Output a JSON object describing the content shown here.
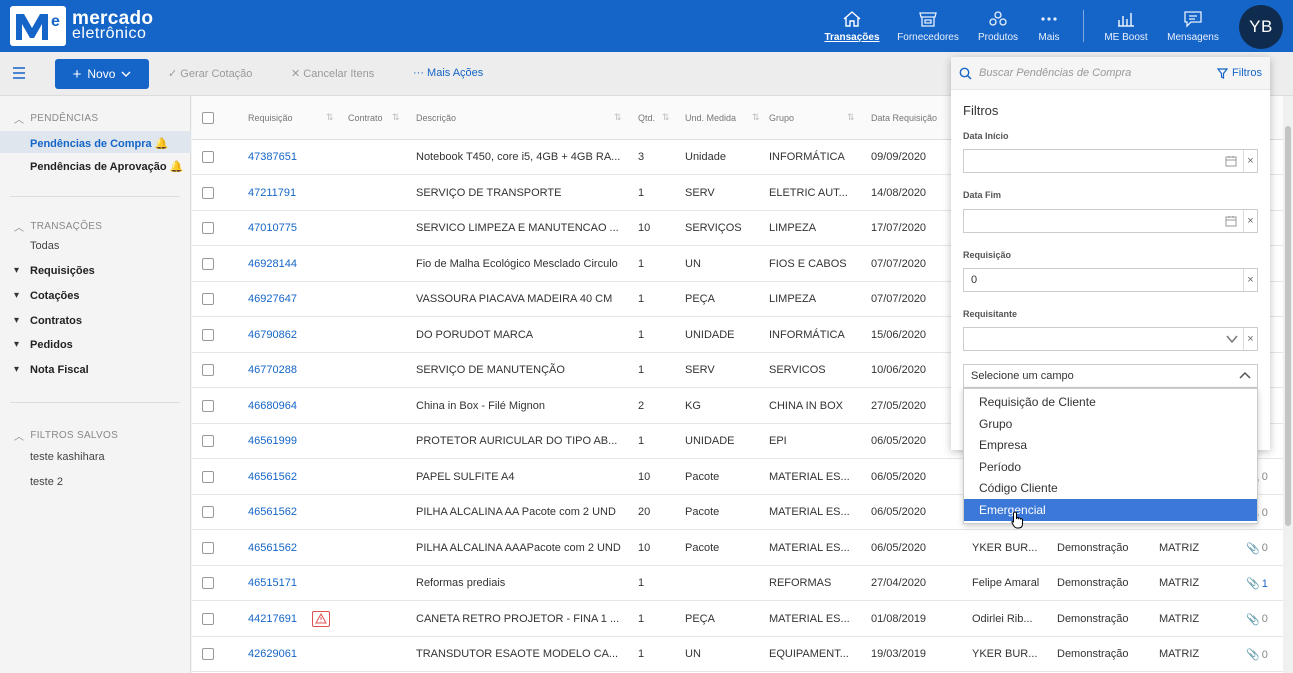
{
  "app": {
    "logo_line1": "mercado",
    "logo_line2": "eletrônico",
    "logo_letters": "Me",
    "brand_color": "#1565c8"
  },
  "topnav": {
    "items": [
      {
        "label": "Transações",
        "icon": "home-icon",
        "active": true
      },
      {
        "label": "Fornecedores",
        "icon": "store-icon"
      },
      {
        "label": "Produtos",
        "icon": "products-icon"
      },
      {
        "label": "Mais",
        "icon": "more-dots-icon"
      },
      {
        "label": "ME Boost",
        "icon": "chart-icon"
      },
      {
        "label": "Mensagens",
        "icon": "message-icon"
      }
    ],
    "avatar_initials": "YB"
  },
  "toolbar": {
    "new_label": "Novo",
    "actions": [
      "✓ Gerar Cotação",
      "✕ Cancelar Itens",
      "··· Mais Ações"
    ]
  },
  "sidebar": {
    "pendencias_title": "PENDÊNCIAS",
    "pendencias_items": [
      "Pendências de Compra",
      "Pendências de Aprovação"
    ],
    "transacoes_title": "TRANSAÇÕES",
    "todas": "Todas",
    "transacoes_items": [
      "Requisições",
      "Cotações",
      "Contratos",
      "Pedidos",
      "Nota Fiscal"
    ],
    "filtros_title": "FILTROS SALVOS",
    "filtros_items": [
      "teste kashihara",
      "teste 2"
    ]
  },
  "table": {
    "headers": [
      "Requisição",
      "Contrato",
      "Descrição",
      "Qtd.",
      "Und. Medida",
      "Grupo",
      "Data Requisição"
    ],
    "rows": [
      {
        "req": "47387651",
        "desc": "Notebook T450, core i5, 4GB + 4GB RA...",
        "qtd": "3",
        "und": "Unidade",
        "grupo": "INFORMÁTICA",
        "data": "09/09/2020"
      },
      {
        "req": "47211791",
        "desc": "SERVIÇO DE TRANSPORTE",
        "qtd": "1",
        "und": "SERV",
        "grupo": "ELETRIC AUT...",
        "data": "14/08/2020"
      },
      {
        "req": "47010775",
        "desc": "SERVICO LIMPEZA E MANUTENCAO ...",
        "qtd": "10",
        "und": "SERVIÇOS",
        "grupo": "LIMPEZA",
        "data": "17/07/2020"
      },
      {
        "req": "46928144",
        "desc": "Fio de Malha Ecológico Mesclado Circulo",
        "qtd": "1",
        "und": "UN",
        "grupo": "FIOS E CABOS",
        "data": "07/07/2020"
      },
      {
        "req": "46927647",
        "desc": "VASSOURA PIACAVA MADEIRA 40 CM",
        "qtd": "1",
        "und": "PEÇA",
        "grupo": "LIMPEZA",
        "data": "07/07/2020"
      },
      {
        "req": "46790862",
        "desc": "DO PORUDOT MARCA",
        "qtd": "1",
        "und": "UNIDADE",
        "grupo": "INFORMÁTICA",
        "data": "15/06/2020"
      },
      {
        "req": "46770288",
        "desc": "SERVIÇO DE MANUTENÇÃO",
        "qtd": "1",
        "und": "SERV",
        "grupo": "SERVICOS",
        "data": "10/06/2020"
      },
      {
        "req": "46680964",
        "desc": "China in Box - Filé Mignon",
        "qtd": "2",
        "und": "KG",
        "grupo": "CHINA IN BOX",
        "data": "27/05/2020"
      },
      {
        "req": "46561999",
        "desc": "PROTETOR AURICULAR DO TIPO AB...",
        "qtd": "1",
        "und": "UNIDADE",
        "grupo": "EPI",
        "data": "06/05/2020"
      },
      {
        "req": "46561562",
        "desc": "PAPEL SULFITE A4",
        "qtd": "10",
        "und": "Pacote",
        "grupo": "MATERIAL ES...",
        "data": "06/05/2020",
        "clip": "0"
      },
      {
        "req": "46561562",
        "desc": "PILHA ALCALINA AA Pacote com 2 UND",
        "qtd": "20",
        "und": "Pacote",
        "grupo": "MATERIAL ES...",
        "data": "06/05/2020",
        "clip": "0"
      },
      {
        "req": "46561562",
        "desc": "PILHA ALCALINA AAAPacote com 2 UND",
        "qtd": "10",
        "und": "Pacote",
        "grupo": "MATERIAL ES...",
        "data": "06/05/2020",
        "requisitante": "YKER BUR...",
        "empresa": "Demonstração",
        "unidade": "MATRIZ",
        "clip": "0"
      },
      {
        "req": "46515171",
        "desc": "Reformas prediais",
        "qtd": "1",
        "und": "",
        "grupo": "REFORMAS",
        "data": "27/04/2020",
        "requisitante": "Felipe Amaral",
        "empresa": "Demonstração",
        "unidade": "MATRIZ",
        "clip": "1"
      },
      {
        "req": "44217691",
        "desc": "CANETA RETRO PROJETOR - FINA 1 ...",
        "qtd": "1",
        "und": "PEÇA",
        "grupo": "MATERIAL ES...",
        "data": "01/08/2019",
        "requisitante": "Odirlei Rib...",
        "empresa": "Demonstração",
        "unidade": "MATRIZ",
        "clip": "0",
        "alert": true
      },
      {
        "req": "42629061",
        "desc": "TRANSDUTOR ESAOTE MODELO CA...",
        "qtd": "1",
        "und": "UN",
        "grupo": "EQUIPAMENT...",
        "data": "19/03/2019",
        "requisitante": "YKER BUR...",
        "empresa": "Demonstração",
        "unidade": "MATRIZ",
        "clip": "0"
      }
    ]
  },
  "filter_panel": {
    "search_placeholder": "Buscar Pendências de Compra",
    "filtros_label": "Filtros",
    "title": "Filtros",
    "data_inicio_label": "Data Início",
    "data_fim_label": "Data Fim",
    "requisicao_label": "Requisição",
    "requisicao_value": "0",
    "requisitante_label": "Requisitante",
    "select_placeholder": "Selecione um campo",
    "options": [
      "Requisição de Cliente",
      "Grupo",
      "Empresa",
      "Período",
      "Código Cliente",
      "Emergencial"
    ],
    "highlighted_index": 5
  }
}
